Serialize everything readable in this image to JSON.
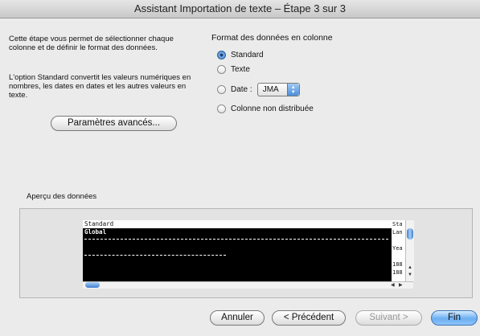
{
  "window": {
    "title": "Assistant Importation de texte – Étape 3 sur 3"
  },
  "description": {
    "text1": "Cette étape vous permet de sélectionner chaque colonne et de définir le format des données.",
    "text2": "L'option Standard convertit les valeurs numériques en nombres, les dates en dates et les autres valeurs en texte."
  },
  "advanced_button": "Paramètres avancés...",
  "format_group": {
    "title": "Format des données en colonne",
    "standard": "Standard",
    "texte": "Texte",
    "date": "Date :",
    "date_value": "JMA",
    "non_distribuee": "Colonne non distribuée"
  },
  "preview": {
    "title": "Aperçu des données",
    "header_col1": "Standard",
    "header_col2": "Sta",
    "row1": "Global",
    "right_rows": [
      "Lan",
      "",
      "Yea",
      "",
      "188",
      "188"
    ]
  },
  "buttons": {
    "annuler": "Annuler",
    "precedent": "< Précédent",
    "suivant": "Suivant >",
    "fin": "Fin"
  }
}
